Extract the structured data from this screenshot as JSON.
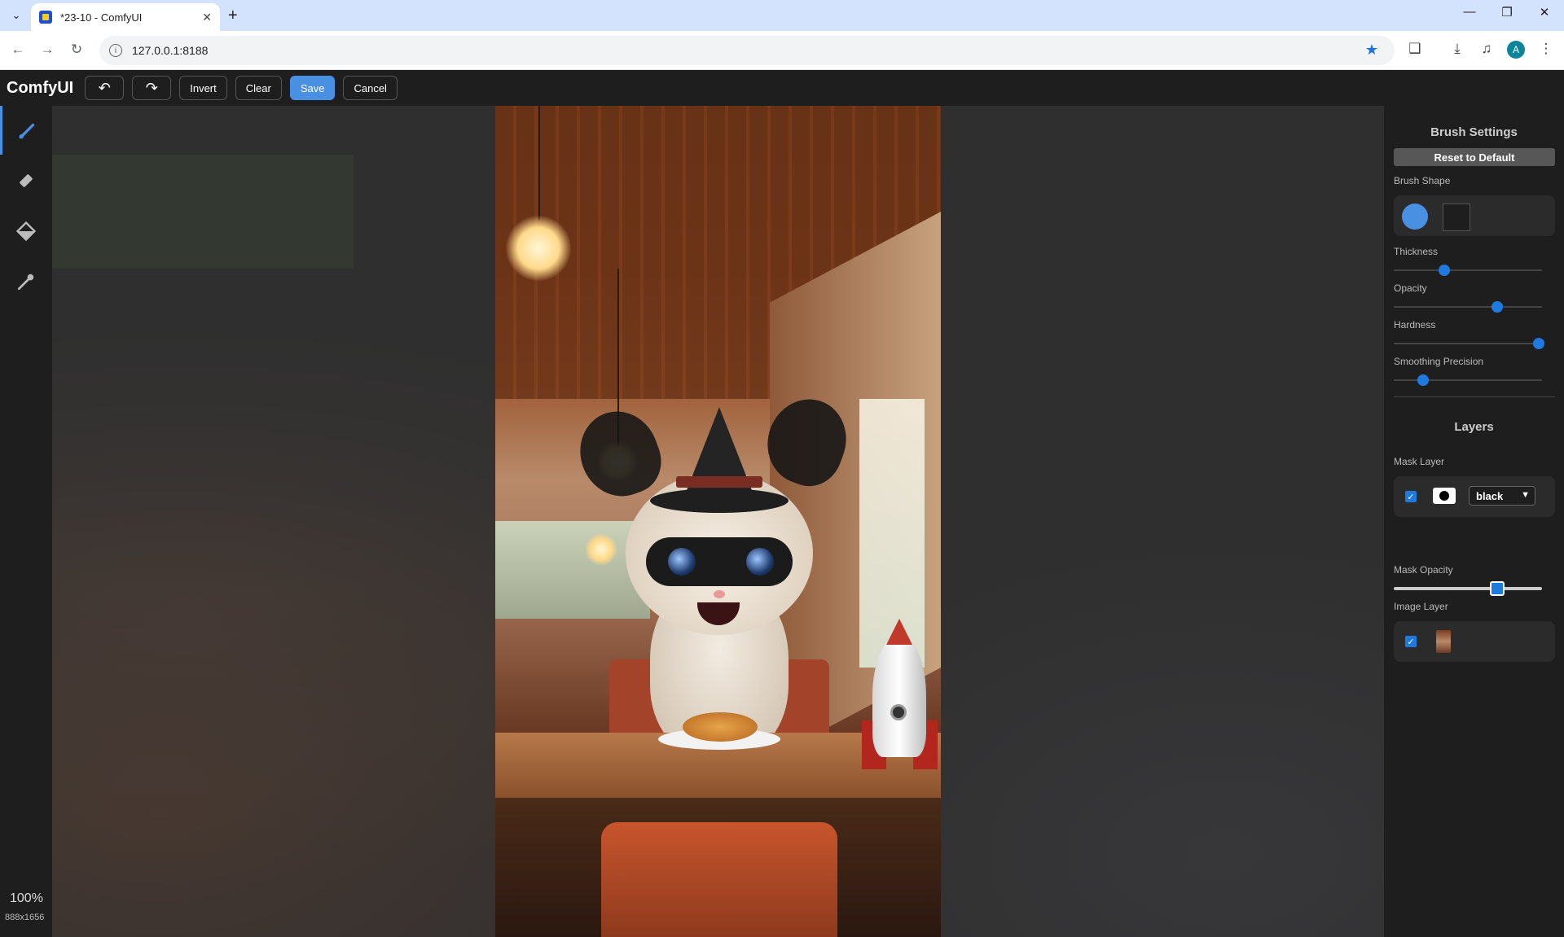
{
  "browser": {
    "tab_title": "*23-10 - ComfyUI",
    "url": "127.0.0.1:8188",
    "profile_initial": "A"
  },
  "app": {
    "brand": "ComfyUI",
    "toolbar": {
      "undo_icon": "undo-icon",
      "redo_icon": "redo-icon",
      "invert_label": "Invert",
      "clear_label": "Clear",
      "save_label": "Save",
      "cancel_label": "Cancel"
    },
    "tools": [
      "brush-icon",
      "eraser-icon",
      "paint-bucket-icon",
      "color-picker-icon"
    ],
    "zoom": "100%",
    "image_dims": "888x1656"
  },
  "panel": {
    "brush_title": "Brush Settings",
    "reset_label": "Reset to Default",
    "brush_shape_label": "Brush Shape",
    "thickness_label": "Thickness",
    "opacity_label": "Opacity",
    "hardness_label": "Hardness",
    "smoothing_label": "Smoothing Precision",
    "sliders": {
      "thickness": 0.34,
      "opacity": 0.7,
      "hardness": 0.98,
      "smoothing": 0.2
    },
    "layers_title": "Layers",
    "mask_layer_label": "Mask Layer",
    "mask_color": "black",
    "mask_opacity_label": "Mask Opacity",
    "mask_opacity": 0.7,
    "image_layer_label": "Image Layer"
  },
  "colors": {
    "accent": "#4a90e2",
    "slider": "#1f7ae0"
  }
}
